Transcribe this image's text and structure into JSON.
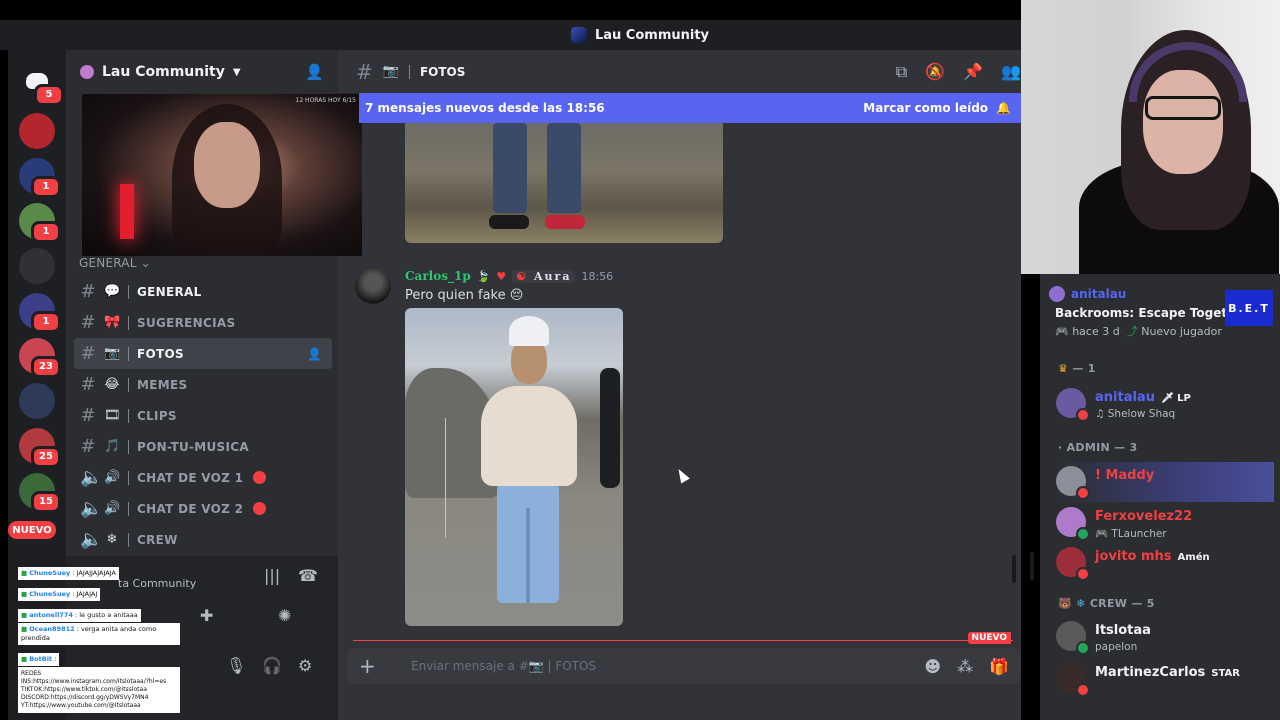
{
  "window": {
    "title": "Lau Community"
  },
  "server": {
    "name": "Lau Community"
  },
  "rail": {
    "home_badge": "5",
    "servers": [
      {
        "color": "#b3262d",
        "badge": ""
      },
      {
        "color": "#2a3b7a",
        "badge": "1"
      },
      {
        "color": "#5a8a4a",
        "badge": "1"
      },
      {
        "color": "#2f3136",
        "badge": ""
      },
      {
        "color": "#3b3f88",
        "badge": "1"
      },
      {
        "color": "#c94552",
        "badge": "23"
      },
      {
        "color": "#2d3a5a",
        "badge": ""
      },
      {
        "color": "#b13a3e",
        "badge": "25"
      },
      {
        "color": "#3a6a3a",
        "badge": "15"
      }
    ],
    "nuevo": "NUEVO"
  },
  "stream_overlay_left": {
    "corner_text": "12 HORAS HOY 6/15"
  },
  "category": {
    "name": "GENERAL"
  },
  "channels": [
    {
      "icon": "💬",
      "name": "GENERAL",
      "bright": true
    },
    {
      "icon": "🎀",
      "name": "SUGERENCIAS"
    },
    {
      "icon": "📷",
      "name": "FOTOS",
      "active": true
    },
    {
      "icon": "😂",
      "name": "MEMES"
    },
    {
      "icon": "🎞",
      "name": "CLIPS"
    },
    {
      "icon": "🎵",
      "name": "PON-TU-MUSICA"
    },
    {
      "icon": "🔊",
      "name": "CHAT DE VOZ 1",
      "live": true
    },
    {
      "icon": "🔊",
      "name": "CHAT DE VOZ 2",
      "live": true
    },
    {
      "icon": "❄",
      "name": "CREW"
    }
  ],
  "user_panel": {
    "subtitle": "ta Community"
  },
  "chat_overlay": {
    "rows": [
      {
        "user": "ChuneSuey",
        "text": ": JAJAJJAJAJAJA"
      },
      {
        "user": "ChuneSuey",
        "text": ": JAJAJAJ"
      },
      {
        "user": "antonell774",
        "text": ": le gusto a anitaaa"
      },
      {
        "user": "Ocean89812",
        "text": ": verga anita anda como prendida"
      },
      {
        "user": "BotBit",
        "text": ":"
      }
    ],
    "redes_title": "REDES",
    "redes_lines": [
      "INS:https://www.instagram.com/itslotaaa/?hl=es",
      "TIKTOK:https://www.tiktok.com/@itsslotaa",
      "DISCORD:https://discord.gg/yDWSVy7MN4",
      "YT:https://www.youtube.com/@Itslotaaa"
    ]
  },
  "channel_header": {
    "icon": "📷",
    "name": "FOTOS"
  },
  "new_messages_bar": {
    "text": "7 mensajes nuevos desde las 18:56",
    "action": "Marcar como leído"
  },
  "message": {
    "author": "Carlos_1p",
    "tag": "Aura",
    "time": "18:56",
    "text": "Pero quien fake 😔"
  },
  "new_divider": {
    "label": "NUEVO"
  },
  "composer": {
    "placeholder": "Enviar mensaje a #📷 | FOTOS"
  },
  "activity": {
    "user": "anitalau",
    "game": "Backrooms: Escape Together",
    "time": "hace 3 d",
    "status": "Nuevo jugador",
    "art": "B.E.T"
  },
  "member_groups": [
    {
      "label": "— 1"
    },
    {
      "label": "ADMIN — 3"
    },
    {
      "label": "CREW — 5"
    }
  ],
  "members": [
    {
      "name": "anitalau",
      "pill": "🗡 LP",
      "sub": "♫ Shelow Shaq",
      "color": "#5865f2"
    },
    {
      "name": "! Maddy",
      "sub": "",
      "color": "#f23f43"
    },
    {
      "name": "Ferxovelez22",
      "sub": "🎮 TLauncher",
      "color": "#f23f43"
    },
    {
      "name": "jovito mhs",
      "pill": "Amén",
      "sub": "",
      "color": "#f23f43"
    },
    {
      "name": "Itslotaa",
      "sub": "papelon",
      "color": "#f2f3f5"
    },
    {
      "name": "MartinezCarlos",
      "pill": "STAR",
      "sub": "",
      "color": "#f2f3f5"
    }
  ]
}
